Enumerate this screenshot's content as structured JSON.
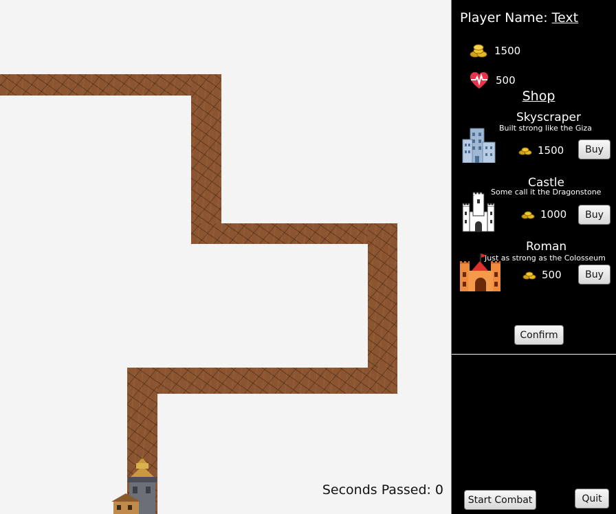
{
  "player": {
    "label": "Player Name:",
    "name": "Text"
  },
  "stats": {
    "coins": "1500",
    "health": "500"
  },
  "shop": {
    "title": "Shop",
    "items": [
      {
        "name": "Skyscraper",
        "description": "Built strong like the Giza",
        "price": "1500",
        "buy_label": "Buy"
      },
      {
        "name": "Castle",
        "description": "Some call it the Dragonstone",
        "price": "1000",
        "buy_label": "Buy"
      },
      {
        "name": "Roman",
        "description": "Just as strong as the Colosseum",
        "price": "500",
        "buy_label": "Buy"
      }
    ],
    "confirm_label": "Confirm"
  },
  "game": {
    "seconds_label": "Seconds Passed:",
    "seconds_value": "0"
  },
  "controls": {
    "start_label": "Start Combat",
    "quit_label": "Quit"
  },
  "colors": {
    "path": "#8a5530",
    "panel": "#000000",
    "background": "#f4f4f4"
  },
  "icons": [
    "coins-icon",
    "heart-pulse-icon",
    "skyscraper-icon",
    "castle-icon",
    "roman-castle-icon",
    "monument-tower-icon"
  ]
}
